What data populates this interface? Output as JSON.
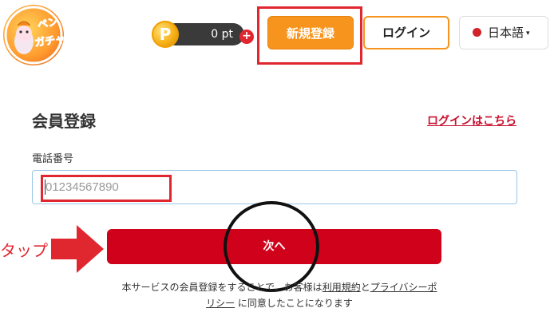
{
  "header": {
    "logo_alt": "ペンギンガチャ",
    "points_coin": "P",
    "points_value": "0 pt",
    "points_add": "+",
    "register_label": "新規登録",
    "login_label": "ログイン",
    "language_label": "日本語",
    "language_caret": "▾"
  },
  "form": {
    "title": "会員登録",
    "login_link": "ログインはこちら",
    "phone_label": "電話番号",
    "phone_placeholder": "01234567890",
    "next_label": "次へ",
    "terms_prefix": "本サービスの会員登録をすることで、お客様は",
    "terms_link": "利用規約",
    "terms_and": "と",
    "privacy_link": "プライバシーポリシー",
    "terms_suffix": "に同意したことになります"
  },
  "annotation": {
    "tap_label": "タップ"
  },
  "colors": {
    "accent_orange": "#f7941d",
    "primary_red": "#d0021b",
    "highlight_red": "#e0262f"
  }
}
